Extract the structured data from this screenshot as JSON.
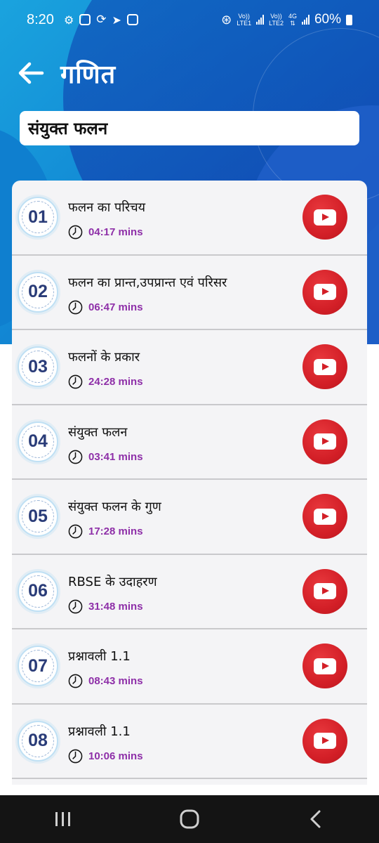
{
  "status_bar": {
    "time": "8:20",
    "sim1": "LTE1",
    "sim2": "LTE2",
    "net": "4G",
    "battery": "60%"
  },
  "header": {
    "title": "गणित",
    "back_icon": "arrow-left-icon"
  },
  "chapter": {
    "title": "संयुक्त फलन"
  },
  "videos": [
    {
      "number": "01",
      "title": "फलन का परिचय",
      "duration": "04:17 mins"
    },
    {
      "number": "02",
      "title": "फलन का प्रान्त,उपप्रान्त एवं परिसर",
      "duration": "06:47 mins"
    },
    {
      "number": "03",
      "title": "फलनों के प्रकार",
      "duration": "24:28 mins"
    },
    {
      "number": "04",
      "title": "संयुक्त फलन",
      "duration": "03:41 mins"
    },
    {
      "number": "05",
      "title": "संयुक्त फलन के गुण",
      "duration": "17:28 mins"
    },
    {
      "number": "06",
      "title": "RBSE के उदाहरण",
      "duration": "31:48 mins"
    },
    {
      "number": "07",
      "title": "प्रश्नावली 1.1",
      "duration": "08:43 mins"
    },
    {
      "number": "08",
      "title": "प्रश्नावली 1.1",
      "duration": "10:06 mins"
    }
  ],
  "colors": {
    "header_blue": "#1288d4",
    "duration_purple": "#8e2fa8",
    "play_red": "#d31f27",
    "number_navy": "#2a3c78"
  },
  "nav_bar": {
    "recents_icon": "recents-icon",
    "home_icon": "home-icon",
    "back_icon": "back-chevron-icon"
  }
}
